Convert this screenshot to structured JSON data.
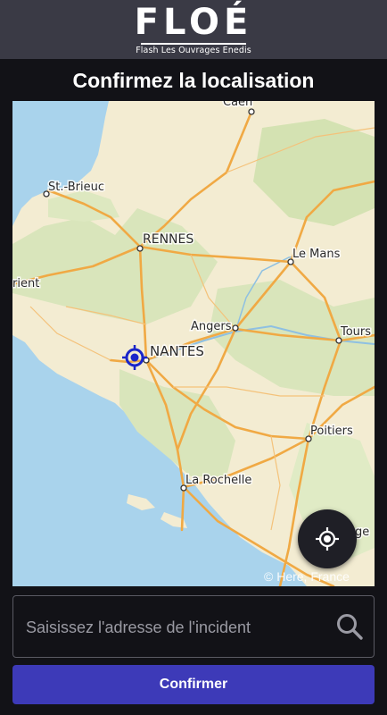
{
  "header": {
    "logo_text": "FLOÉ",
    "logo_subtitle": "Flash Les Ouvrages Enedis"
  },
  "page": {
    "title": "Confirmez la localisation"
  },
  "map": {
    "cities": {
      "caen": "Caen",
      "st_brieuc": "St.-Brieuc",
      "rennes": "RENNES",
      "le_mans": "Le Mans",
      "lorient": "rient",
      "angers": "Angers",
      "tours": "Tours",
      "nantes": "NANTES",
      "poitiers": "Poitiers",
      "la_rochelle": "La Rochelle",
      "angouleme": "oge"
    },
    "attribution": "© Here, France",
    "marker_icon": "crosshair-target-icon",
    "locate_icon": "gps-locate-icon"
  },
  "search": {
    "placeholder": "Saisissez l'adresse de l'incident",
    "value": "",
    "icon": "search-icon"
  },
  "actions": {
    "confirm_label": "Confirmer"
  },
  "colors": {
    "header_bg": "#3a3a45",
    "page_bg": "#121217",
    "sea": "#a9d3ec",
    "land": "#f3ecd2",
    "forest": "#d7e3b8",
    "road": "#f0a944",
    "marker": "#1a25c9",
    "button": "#3d3ab8"
  }
}
